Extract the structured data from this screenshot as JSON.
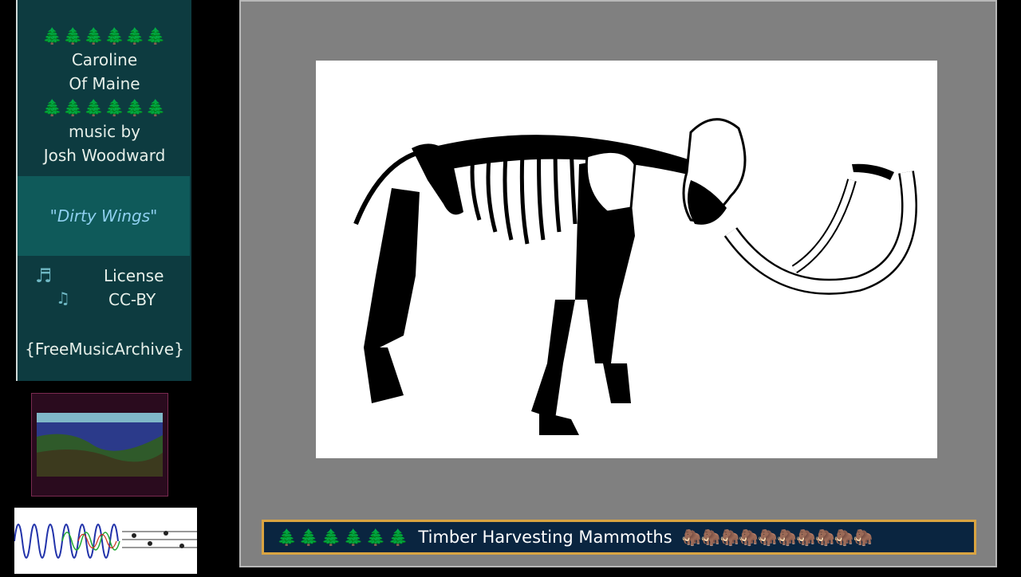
{
  "sidebar": {
    "trees": "🌲🌲🌲🌲🌲🌲",
    "song_lines": [
      "Caroline",
      "Of Maine"
    ],
    "credit_lines": [
      "music by",
      "Josh Woodward"
    ],
    "track_title": "\"Dirty Wings\"",
    "license_lines": [
      "License",
      "CC-BY"
    ],
    "note_icons": [
      "♬",
      "♫"
    ],
    "archive": "{FreeMusicArchive}"
  },
  "banner": {
    "trees": "🌲🌲🌲🌲🌲🌲",
    "title": "Timber Harvesting Mammoths",
    "mammoths": "🦣🦣🦣🦣🦣🦣🦣🦣🦣🦣"
  },
  "colors": {
    "sidebar_bg": "#0d3b40",
    "song_box_bg": "#0f5a5a",
    "viewer_bg": "#808080",
    "banner_bg": "#0a2540",
    "banner_border": "#d9a441"
  }
}
